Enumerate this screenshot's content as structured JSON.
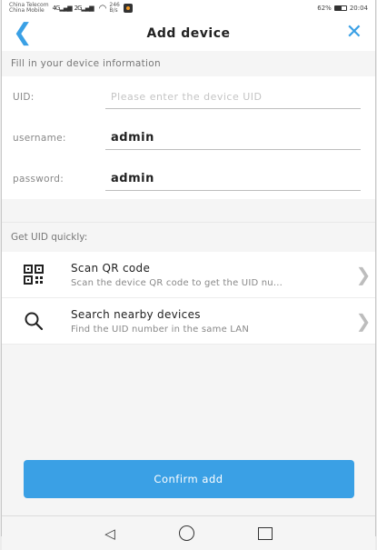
{
  "status": {
    "carrier1": "China Telecom",
    "carrier2": "China Mobile",
    "net1": "4G",
    "net2": "2G",
    "speed": "246",
    "speed_unit": "B/s",
    "battery": "62%",
    "battery_level": 0.62,
    "time": "20:04"
  },
  "nav": {
    "title": "Add device"
  },
  "form": {
    "header": "Fill in your device information",
    "uid_label": "UID:",
    "uid_placeholder": "Please enter the device UID",
    "username_label": "username:",
    "username_value": "admin",
    "password_label": "password:",
    "password_value": "admin"
  },
  "quick": {
    "header": "Get UID quickly:",
    "options": [
      {
        "title": "Scan QR code",
        "subtitle": "Scan the device QR code to get the UID nu...",
        "icon": "qr-code-icon"
      },
      {
        "title": "Search nearby devices",
        "subtitle": "Find the UID number in the same LAN",
        "icon": "search-icon"
      }
    ]
  },
  "confirm_label": "Confirm add",
  "colors": {
    "accent": "#3aa0e5"
  }
}
